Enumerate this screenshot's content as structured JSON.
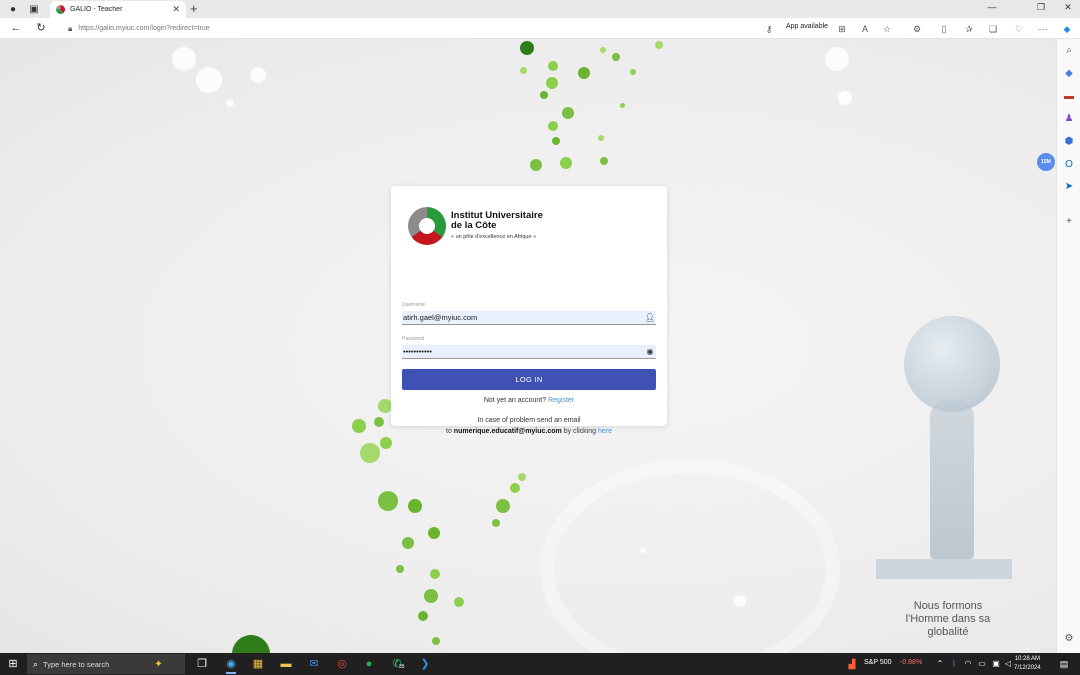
{
  "browser": {
    "tab_title": "GALIO - Teacher",
    "url": "https://galio.myiuc.com/login?redirect=true",
    "app_available": "App available"
  },
  "badge": "15M",
  "login": {
    "institution_line1": "Institut Universitaire",
    "institution_line2": "de la Côte",
    "tagline": "« un pôle d'excellence en Afrique »",
    "username_label": "Username",
    "username_value": "atirh.gael@myiuc.com",
    "password_label": "Password",
    "password_value": "•••••••••••",
    "login_button": "LOG IN",
    "not_yet": "Not yet an account?",
    "register": "Register",
    "help_line1": "In case of problem send an email",
    "help_to": "to",
    "help_email": "numerique.educatif@myiuc.com",
    "help_by": "by clicking",
    "help_here": "here"
  },
  "background": {
    "slogan": "Nous formons l'Homme dans sa globalité"
  },
  "taskbar": {
    "search_placeholder": "Type here to search",
    "stock_name": "S&P 500",
    "stock_change": "-0.88%",
    "time": "10:28 AM",
    "date": "7/12/2024",
    "whatsapp_badge": "35"
  },
  "colors": {
    "accent": "#3f51b5",
    "link": "#4a90d9",
    "autofill": "#e8f0fe",
    "green": "#7bc043"
  }
}
